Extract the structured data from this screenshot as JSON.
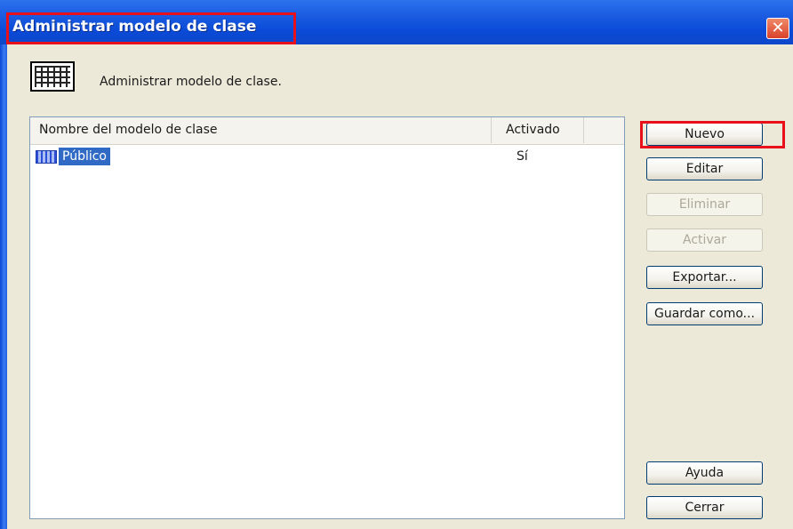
{
  "window": {
    "title": "Administrar modelo de clase",
    "close_glyph": "✕"
  },
  "header": {
    "icon": "grid-table-icon",
    "text": "Administrar modelo de clase."
  },
  "list": {
    "columns": [
      "Nombre del modelo de clase",
      "Activado"
    ],
    "rows": [
      {
        "name": "Público",
        "active": "Sí",
        "icon": "class-model-icon",
        "selected": true
      }
    ]
  },
  "buttons": {
    "nuevo": "Nuevo",
    "editar": "Editar",
    "eliminar": "Eliminar",
    "activar": "Activar",
    "exportar": "Exportar...",
    "guardar_como": "Guardar como...",
    "ayuda": "Ayuda",
    "cerrar": "Cerrar"
  },
  "colors": {
    "titlebar": "#0a4ad8",
    "highlight": "#e8101a",
    "selection": "#316ac5"
  }
}
